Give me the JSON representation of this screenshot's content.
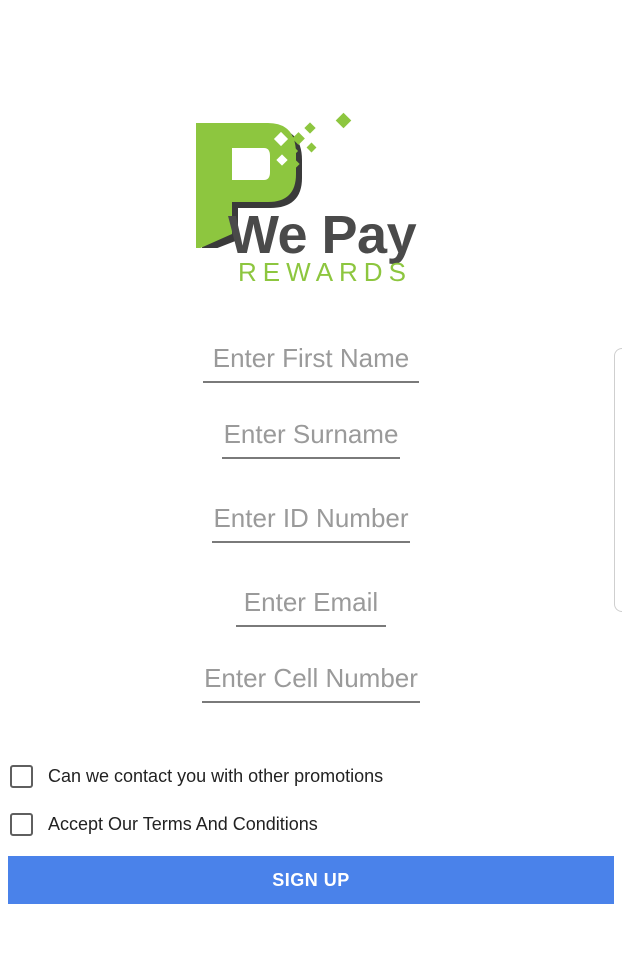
{
  "logo": {
    "line1": "We Pay",
    "line2": "REWARDS"
  },
  "form": {
    "first_name_placeholder": "Enter First Name",
    "surname_placeholder": "Enter Surname",
    "id_number_placeholder": "Enter ID Number",
    "email_placeholder": "Enter Email",
    "cell_number_placeholder": "Enter Cell Number"
  },
  "checkboxes": {
    "promotions_label": "Can we contact you with other promotions",
    "terms_label": "Accept Our Terms And Conditions"
  },
  "signup_button_label": "SIGN UP",
  "colors": {
    "brand_green": "#8dc63f",
    "brand_gray": "#4a4a4a",
    "button_blue": "#4a82ea"
  }
}
